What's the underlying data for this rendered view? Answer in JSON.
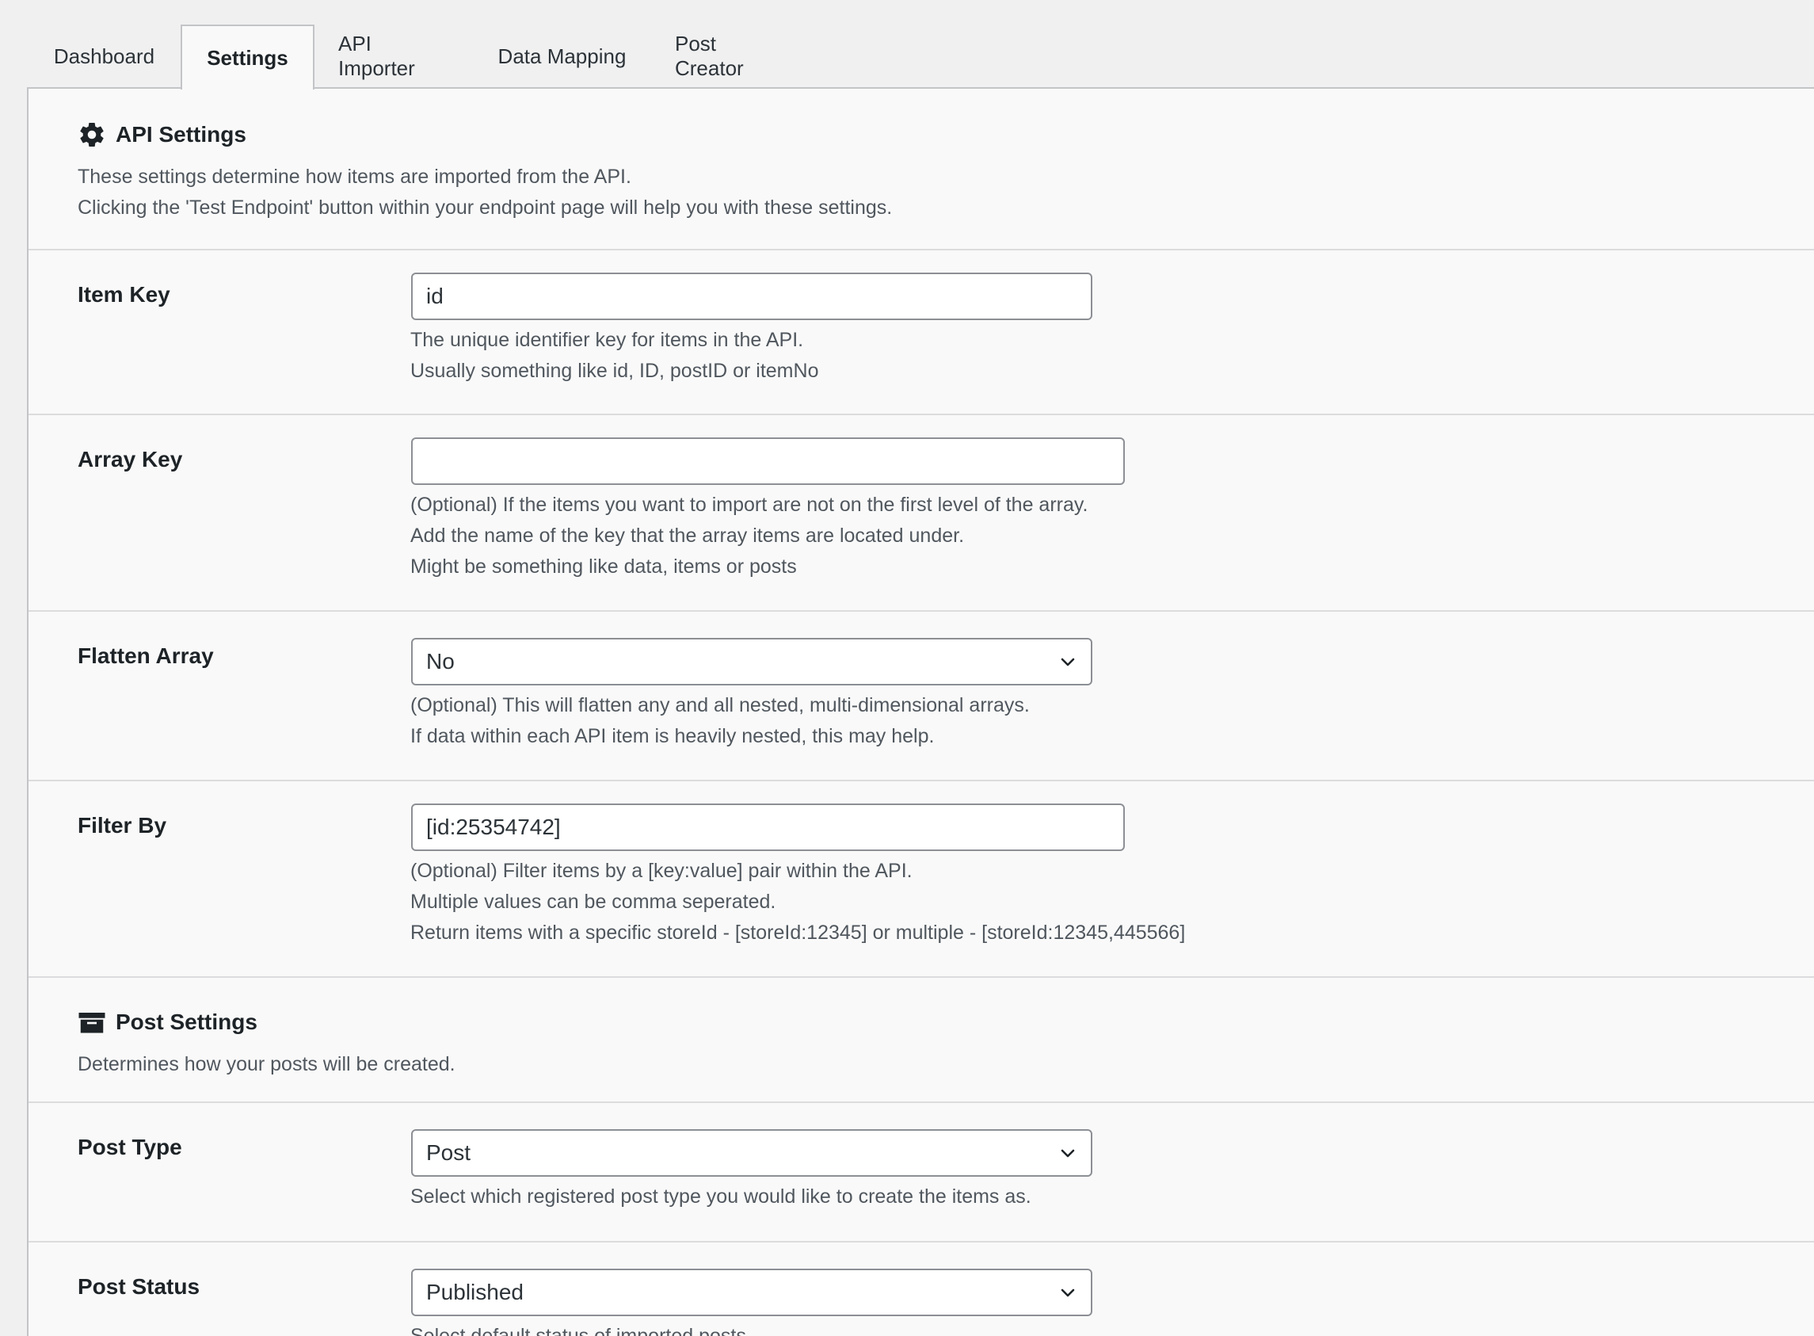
{
  "tabs": [
    {
      "label": "Dashboard",
      "active": false
    },
    {
      "label": "Settings",
      "active": true
    },
    {
      "label": "API Importer",
      "active": false
    },
    {
      "label": "Data Mapping",
      "active": false
    },
    {
      "label": "Post Creator",
      "active": false
    }
  ],
  "api_settings": {
    "title": "API Settings",
    "icon": "gear-icon",
    "description": [
      "These settings determine how items are imported from the API.",
      "Clicking the 'Test Endpoint' button within your endpoint page will help you with these settings."
    ]
  },
  "item_key": {
    "label": "Item Key",
    "value": "id",
    "help": [
      "The unique identifier key for items in the API.",
      "Usually something like id, ID, postID or itemNo"
    ]
  },
  "array_key": {
    "label": "Array Key",
    "value": "",
    "help": [
      "(Optional) If the items you want to import are not on the first level of the array.",
      "Add the name of the key that the array items are located under.",
      "Might be something like data, items or posts"
    ]
  },
  "flatten_array": {
    "label": "Flatten Array",
    "selected": "No",
    "help": [
      "(Optional) This will flatten any and all nested, multi-dimensional arrays.",
      "If data within each API item is heavily nested, this may help."
    ]
  },
  "filter_by": {
    "label": "Filter By",
    "value": "[id:25354742]",
    "help": [
      "(Optional) Filter items by a [key:value] pair within the API.",
      "Multiple values can be comma seperated.",
      "Return items with a specific storeId - [storeId:12345] or multiple - [storeId:12345,445566]"
    ]
  },
  "post_settings": {
    "title": "Post Settings",
    "icon": "archive-icon",
    "description": [
      "Determines how your posts will be created."
    ]
  },
  "post_type": {
    "label": "Post Type",
    "selected": "Post",
    "help": [
      "Select which registered post type you would like to create the items as."
    ]
  },
  "post_status": {
    "label": "Post Status",
    "selected": "Published",
    "help": [
      "Select default status of imported posts."
    ]
  },
  "colors": {
    "page_bg": "#f0f0f1",
    "panel_bg": "#f9f9f9",
    "border": "#c3c4c7",
    "divider": "#dcdcde",
    "text": "#1d2327",
    "muted_text": "#50575e"
  }
}
